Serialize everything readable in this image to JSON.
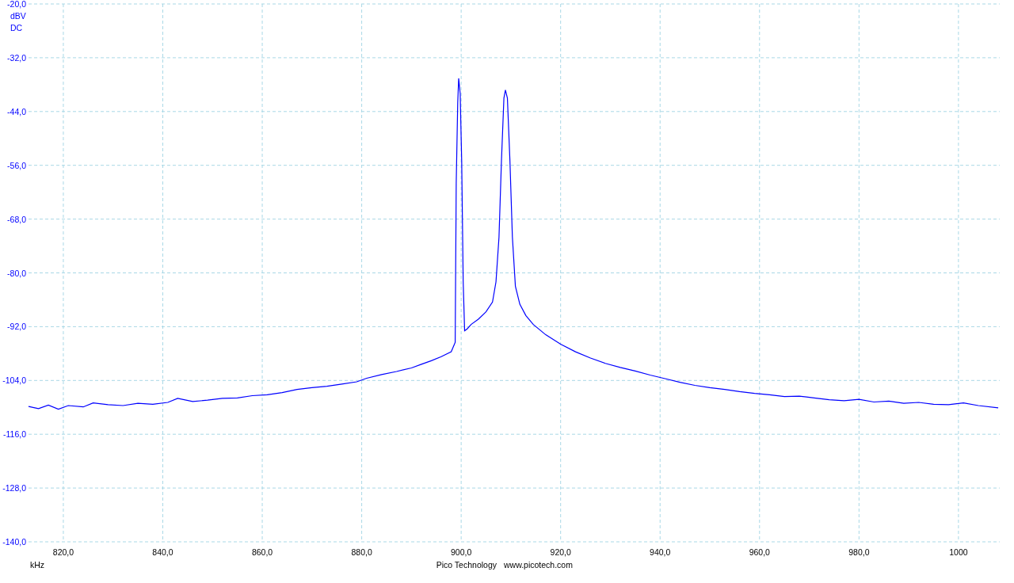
{
  "chart": {
    "coupling": "DC",
    "chart_data": {
      "type": "line",
      "grid": true,
      "xlabel": "kHz",
      "ylabel": "dBV",
      "xlim": [
        813,
        1008.3
      ],
      "ylim": [
        -140,
        -20
      ],
      "yticks": [
        {
          "value": -20,
          "label": "-20,0"
        },
        {
          "value": -32,
          "label": "-32,0"
        },
        {
          "value": -44,
          "label": "-44,0"
        },
        {
          "value": -56,
          "label": "-56,0"
        },
        {
          "value": -68,
          "label": "-68,0"
        },
        {
          "value": -80,
          "label": "-80,0"
        },
        {
          "value": -92,
          "label": "-92,0"
        },
        {
          "value": -104,
          "label": "-104,0"
        },
        {
          "value": -116,
          "label": "-116,0"
        },
        {
          "value": -128,
          "label": "-128,0"
        },
        {
          "value": -140,
          "label": "-140,0"
        }
      ],
      "xticks": [
        {
          "value": 820,
          "label": "820,0"
        },
        {
          "value": 840,
          "label": "840,0"
        },
        {
          "value": 860,
          "label": "860,0"
        },
        {
          "value": 880,
          "label": "880,0"
        },
        {
          "value": 900,
          "label": "900,0"
        },
        {
          "value": 920,
          "label": "920,0"
        },
        {
          "value": 940,
          "label": "940,0"
        },
        {
          "value": 960,
          "label": "960,0"
        },
        {
          "value": 980,
          "label": "980,0"
        },
        {
          "value": 1000,
          "label": "1000"
        }
      ],
      "x": [
        813,
        815,
        817,
        819,
        821,
        824,
        826,
        829,
        832,
        835,
        838,
        841,
        843,
        846,
        849,
        852,
        855,
        858,
        861,
        864,
        867,
        870,
        873,
        876,
        879,
        881,
        884,
        887,
        890,
        892,
        894,
        896,
        898,
        898.8,
        899.0,
        899.3,
        899.5,
        899.8,
        900.1,
        900.4,
        900.7,
        901.2,
        902,
        903.5,
        905,
        906.3,
        907,
        907.6,
        908.1,
        908.6,
        908.9,
        909.3,
        909.8,
        910.3,
        910.9,
        911.8,
        913,
        914.5,
        917,
        920,
        923,
        926,
        929,
        932,
        935,
        938,
        941,
        944,
        947,
        950,
        953,
        956,
        959,
        962,
        965,
        968,
        971,
        974,
        977,
        980,
        983,
        986,
        989,
        992,
        995,
        998,
        1001,
        1004,
        1008
      ],
      "series": [
        {
          "color": "#0000ff",
          "values": [
            -109.8,
            -110.3,
            -109.5,
            -110.4,
            -109.6,
            -109.9,
            -109.0,
            -109.4,
            -109.6,
            -109.1,
            -109.3,
            -108.9,
            -108.0,
            -108.7,
            -108.4,
            -108.0,
            -107.9,
            -107.4,
            -107.2,
            -106.7,
            -106.0,
            -105.6,
            -105.3,
            -104.8,
            -104.3,
            -103.5,
            -102.7,
            -102.0,
            -101.2,
            -100.4,
            -99.6,
            -98.7,
            -97.6,
            -95.5,
            -60,
            -42,
            -36.6,
            -40,
            -55,
            -82,
            -92.9,
            -92.5,
            -91.5,
            -90.3,
            -88.7,
            -86.5,
            -82,
            -72,
            -55,
            -41,
            -39.2,
            -41,
            -55,
            -72,
            -83,
            -87,
            -89.5,
            -91.5,
            -93.8,
            -95.9,
            -97.6,
            -99.0,
            -100.2,
            -101.1,
            -101.9,
            -102.8,
            -103.6,
            -104.4,
            -105.1,
            -105.6,
            -106.0,
            -106.5,
            -106.9,
            -107.2,
            -107.6,
            -107.5,
            -107.9,
            -108.3,
            -108.5,
            -108.2,
            -108.8,
            -108.6,
            -109.1,
            -108.9,
            -109.3,
            -109.4,
            -109.0,
            -109.6,
            -110.1
          ]
        }
      ]
    }
  },
  "footer": {
    "brand": "Pico Technology",
    "url": "www.picotech.com"
  }
}
